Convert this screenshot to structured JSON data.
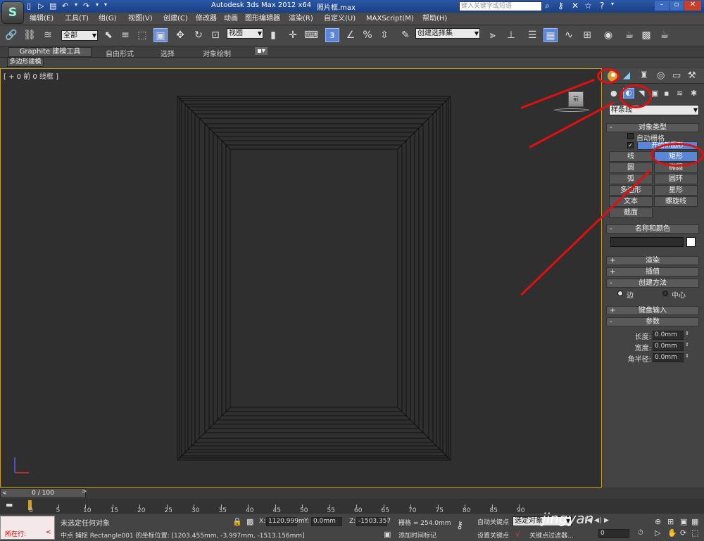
{
  "window": {
    "title": "Autodesk 3ds Max  2012 x64",
    "file": "照片框.max",
    "search_placeholder": "键入关键字或短语"
  },
  "menu": [
    "编辑(E)",
    "工具(T)",
    "组(G)",
    "视图(V)",
    "创建(C)",
    "修改器",
    "动画",
    "图形编辑器",
    "渲染(R)",
    "自定义(U)",
    "MAXScript(M)",
    "帮助(H)"
  ],
  "toolbar": {
    "selection_filter": "全部",
    "ref_coord": "视图",
    "named_selection": "创建选择集"
  },
  "ribbon": {
    "tabs": [
      "Graphite 建模工具",
      "自由形式",
      "选择",
      "对象绘制"
    ],
    "sub": "多边形建模"
  },
  "viewport": {
    "label": "[ + 0 前 0 线框 ]",
    "viewcube": "前"
  },
  "panel": {
    "category_dropdown": "样条线",
    "object_type": {
      "title": "对象类型",
      "auto_grid": "自动栅格",
      "start_new_shape": "开始新图形",
      "buttons": [
        "线",
        "矩形",
        "圆",
        "椭圆",
        "弧",
        "圆环",
        "多边形",
        "星形",
        "文本",
        "螺旋线",
        "截面"
      ]
    },
    "name_color": {
      "title": "名称和颜色"
    },
    "rendering": {
      "title": "渲染"
    },
    "interpolation": {
      "title": "插值"
    },
    "creation_method": {
      "title": "创建方法",
      "edge": "边",
      "center": "中心"
    },
    "keyboard_entry": {
      "title": "键盘输入"
    },
    "parameters": {
      "title": "参数",
      "length_label": "长度:",
      "length": "0.0mm",
      "width_label": "宽度:",
      "width": "0.0mm",
      "corner_label": "角半径:",
      "corner": "0.0mm"
    }
  },
  "trackbar": {
    "frame": "0 / 100",
    "ticks": [
      "0",
      "5",
      "10",
      "15",
      "20",
      "25",
      "30",
      "35",
      "40",
      "45",
      "50",
      "55",
      "60",
      "65",
      "70",
      "75",
      "80",
      "85",
      "90"
    ]
  },
  "status": {
    "running": "所在行:",
    "selection": "未选定任何对象",
    "prompt": "中点 捕捉 Rectangle001 的坐标位置: [1203.455mm, -3.997mm, -1513.156mm]",
    "x_label": "X:",
    "x": "1120.999m",
    "y_label": "Y:",
    "y": "0.0mm",
    "z_label": "Z:",
    "z": "-1503.357",
    "grid": "栅格 = 254.0mm",
    "add_time_tag": "添加时间标记",
    "auto_key": "自动关键点",
    "set_key": "设置关键点",
    "selected": "选定对象",
    "key_filters": "关键点过滤器...",
    "frame_value": "0"
  },
  "watermark": "jingyan"
}
